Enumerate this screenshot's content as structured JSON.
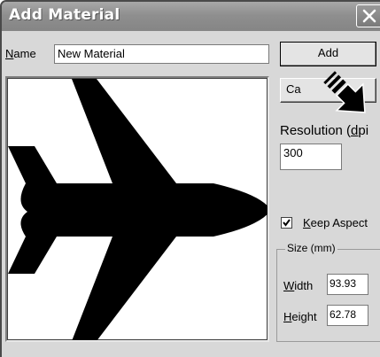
{
  "window": {
    "title": "Add Material"
  },
  "name": {
    "label_hotkey": "N",
    "label_rest": "ame",
    "value": "New Material"
  },
  "buttons": {
    "add_label": "Add",
    "cancel_label": "Ca"
  },
  "resolution": {
    "label_prefix": "Resolution (",
    "label_hotkey": "d",
    "label_rest": "pi",
    "value": "300"
  },
  "keep_aspect": {
    "checked": true,
    "label_hotkey": "K",
    "label_rest": "eep Aspect"
  },
  "size": {
    "group_label": "Size (mm)",
    "width_hotkey": "W",
    "width_rest": "idth",
    "width_value": "93.93",
    "height_hotkey": "H",
    "height_rest": "eight",
    "height_value": "62.78"
  },
  "icons": {
    "close": "close-icon",
    "pointer": "pointer-arrow-icon",
    "preview": "airplane-silhouette"
  },
  "colors": {
    "titlebar": "#8f8f8f",
    "dialog_bg": "#d8d8d8",
    "silhouette": "#000000"
  }
}
